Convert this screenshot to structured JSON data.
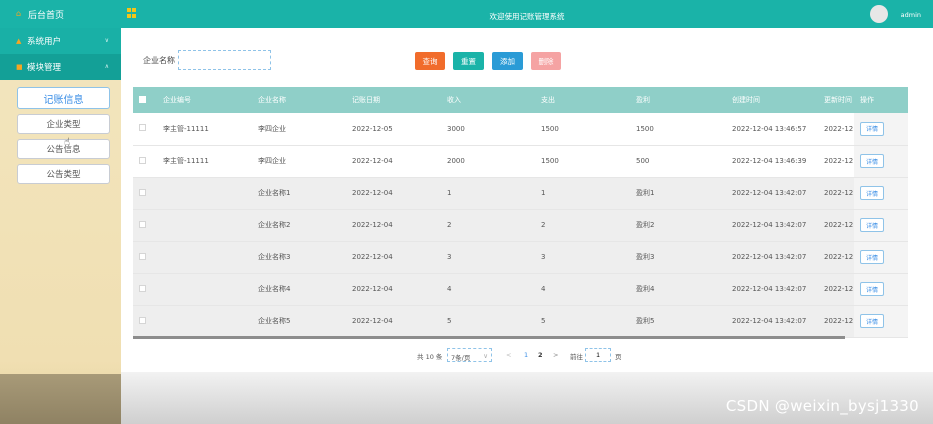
{
  "sidebar": {
    "home_label": "后台首页",
    "groups": [
      {
        "label": "系统用户"
      },
      {
        "label": "模块管理"
      }
    ],
    "sub_items": [
      {
        "label": "记账信息"
      },
      {
        "label": "企业类型"
      },
      {
        "label": "公告信息"
      },
      {
        "label": "公告类型"
      }
    ]
  },
  "header": {
    "title": "欢迎使用记账管理系统",
    "user": "admin"
  },
  "search": {
    "label": "企业名称",
    "value": ""
  },
  "toolbar": {
    "query_label": "查询",
    "reset_label": "重置",
    "add_label": "添加",
    "delete_label": "删除"
  },
  "table": {
    "columns": [
      "企业编号",
      "企业名称",
      "记账日期",
      "收入",
      "支出",
      "盈利",
      "创建时间",
      "更新时间",
      "操作"
    ],
    "detail_label": "详情",
    "rows": [
      [
        "李主管-11111",
        "李四企业",
        "2022-12-05",
        "3000",
        "1500",
        "1500",
        "2022-12-04 13:46:57",
        "2022-12"
      ],
      [
        "李主管-11111",
        "李四企业",
        "2022-12-04",
        "2000",
        "1500",
        "500",
        "2022-12-04 13:46:39",
        "2022-12"
      ],
      [
        "",
        "企业名称1",
        "2022-12-04",
        "1",
        "1",
        "盈利1",
        "2022-12-04 13:42:07",
        "2022-12"
      ],
      [
        "",
        "企业名称2",
        "2022-12-04",
        "2",
        "2",
        "盈利2",
        "2022-12-04 13:42:07",
        "2022-12"
      ],
      [
        "",
        "企业名称3",
        "2022-12-04",
        "3",
        "3",
        "盈利3",
        "2022-12-04 13:42:07",
        "2022-12"
      ],
      [
        "",
        "企业名称4",
        "2022-12-04",
        "4",
        "4",
        "盈利4",
        "2022-12-04 13:42:07",
        "2022-12"
      ],
      [
        "",
        "企业名称5",
        "2022-12-04",
        "5",
        "5",
        "盈利5",
        "2022-12-04 13:42:07",
        "2022-12"
      ]
    ]
  },
  "pagination": {
    "total": "共 10 条",
    "page_size": "7条/页",
    "prev": "<",
    "page1": "1",
    "page2": "2",
    "next": ">",
    "goto_label": "前往",
    "goto_value": "1",
    "page_unit": "页"
  },
  "watermark": "CSDN @weixin_bysj1330",
  "colors": {
    "teal": "#1ab3a8",
    "table_header": "#8fcfc8",
    "query": "#f16c2b",
    "add": "#2a9bd6",
    "delete": "#f5a3a3"
  }
}
